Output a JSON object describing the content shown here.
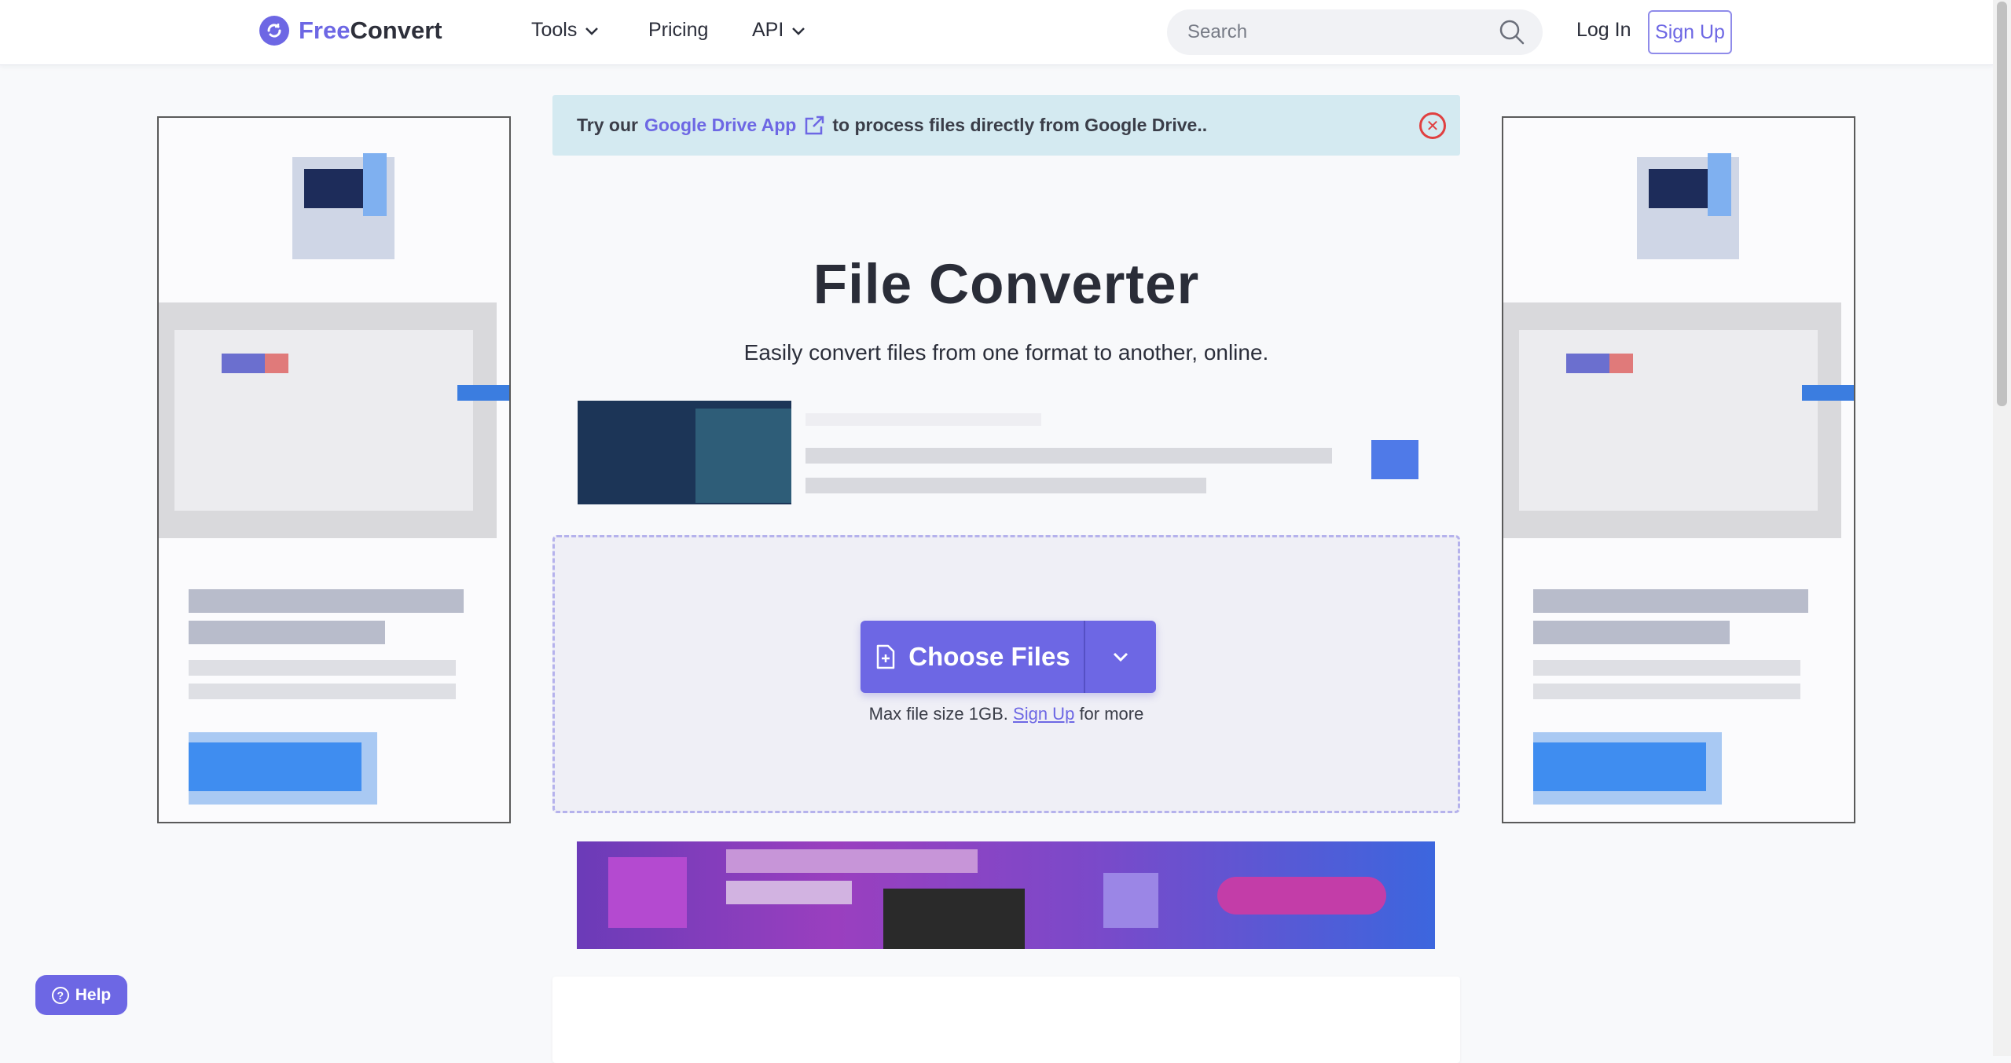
{
  "header": {
    "logo_free": "Free",
    "logo_convert": "Convert",
    "nav": {
      "tools": "Tools",
      "pricing": "Pricing",
      "api": "API"
    },
    "search_placeholder": "Search",
    "login": "Log In",
    "signup": "Sign Up"
  },
  "banner": {
    "prefix": "Try our",
    "link": "Google Drive App",
    "suffix": "to process files directly from Google Drive.."
  },
  "hero": {
    "title": "File Converter",
    "subtitle": "Easily convert files from one format to another, online."
  },
  "upload": {
    "choose_label": "Choose Files",
    "max_prefix": "Max file size 1GB.",
    "max_link": "Sign Up",
    "max_suffix": "for more"
  },
  "help": {
    "label": "Help"
  },
  "colors": {
    "accent": "#6d67e4",
    "banner_bg": "#d4eaf1",
    "close_red": "#e04040"
  }
}
